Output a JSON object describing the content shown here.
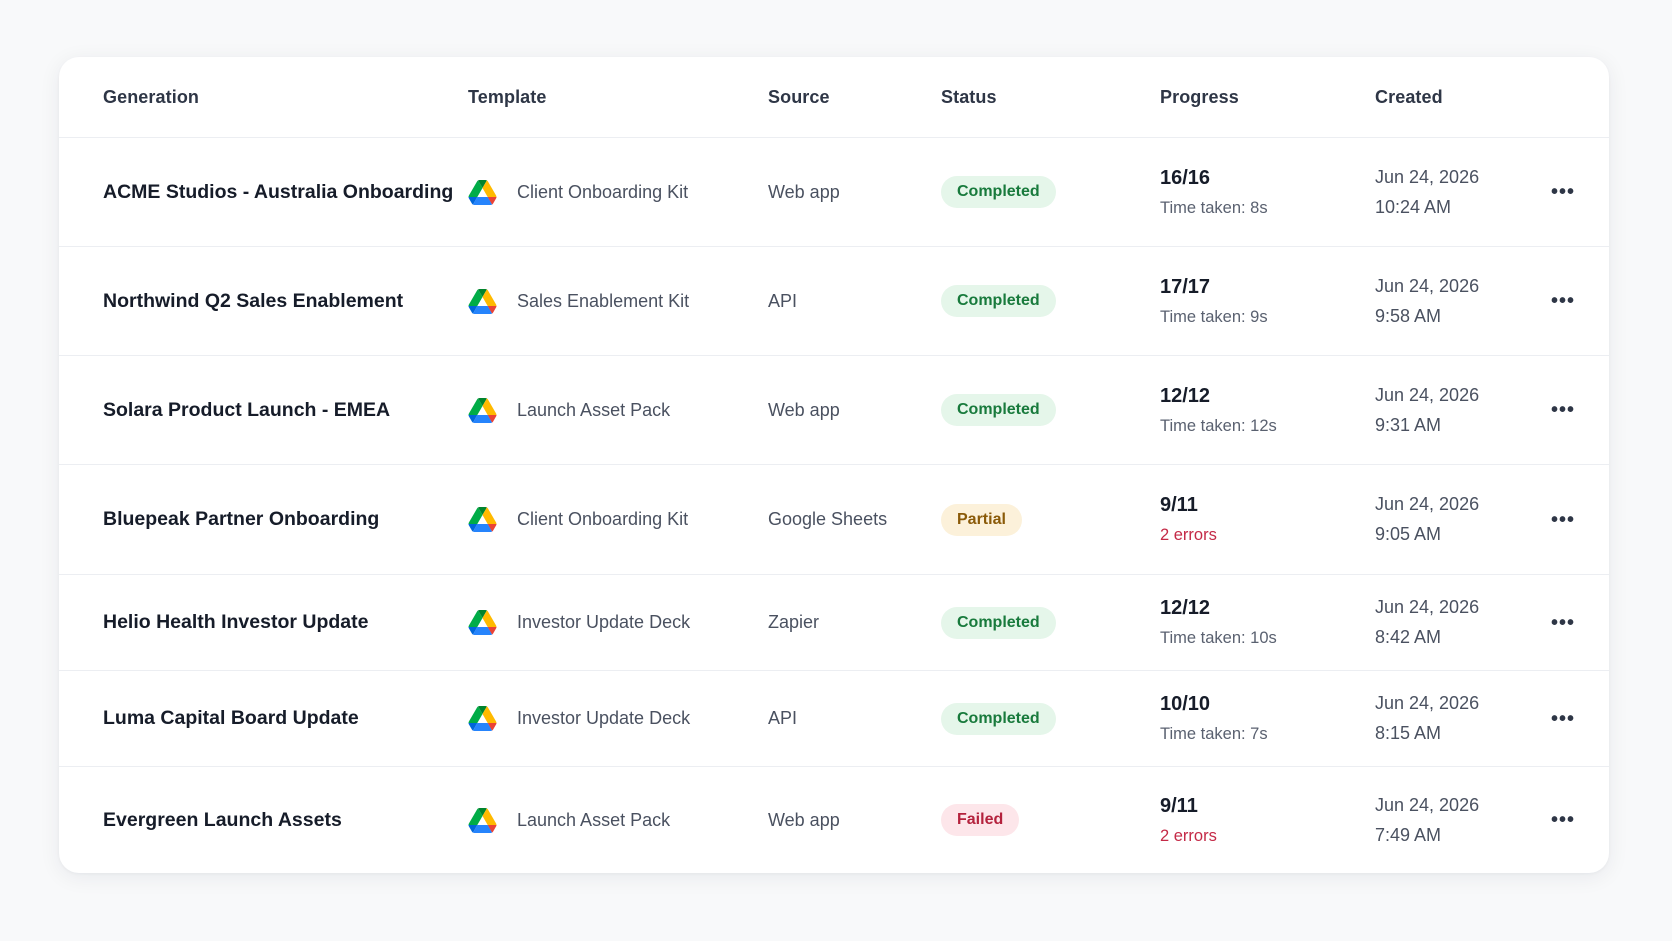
{
  "columns": {
    "generation": "Generation",
    "template": "Template",
    "source": "Source",
    "status": "Status",
    "progress": "Progress",
    "created": "Created"
  },
  "more_glyph": "•••",
  "status_colors": {
    "completed": "#187a3c",
    "partial": "#8a5a08",
    "failed": "#b4223d"
  },
  "rows": [
    {
      "generation": "ACME Studios - Australia Onboarding",
      "template_icon": "google-drive-icon",
      "template": "Client Onboarding Kit",
      "source": "Web app",
      "status": "Completed",
      "status_kind": "completed",
      "progress": "16/16",
      "progress_sub": "Time taken: 8s",
      "has_errors": false,
      "date": "Jun 24, 2026",
      "time": "10:24 AM"
    },
    {
      "generation": "Northwind Q2 Sales Enablement",
      "template_icon": "google-drive-icon",
      "template": "Sales Enablement Kit",
      "source": "API",
      "status": "Completed",
      "status_kind": "completed",
      "progress": "17/17",
      "progress_sub": "Time taken: 9s",
      "has_errors": false,
      "date": "Jun 24, 2026",
      "time": "9:58 AM"
    },
    {
      "generation": "Solara Product Launch - EMEA",
      "template_icon": "google-drive-icon",
      "template": "Launch Asset Pack",
      "source": "Web app",
      "status": "Completed",
      "status_kind": "completed",
      "progress": "12/12",
      "progress_sub": "Time taken: 12s",
      "has_errors": false,
      "date": "Jun 24, 2026",
      "time": "9:31 AM"
    },
    {
      "generation": "Bluepeak Partner Onboarding",
      "template_icon": "google-drive-icon",
      "template": "Client Onboarding Kit",
      "source": "Google Sheets",
      "status": "Partial",
      "status_kind": "partial",
      "progress": "9/11",
      "progress_sub": "2 errors",
      "has_errors": true,
      "date": "Jun 24, 2026",
      "time": "9:05 AM"
    },
    {
      "generation": "Helio Health Investor Update",
      "template_icon": "google-drive-icon",
      "template": "Investor Update Deck",
      "source": "Zapier",
      "status": "Completed",
      "status_kind": "completed",
      "progress": "12/12",
      "progress_sub": "Time taken: 10s",
      "has_errors": false,
      "date": "Jun 24, 2026",
      "time": "8:42 AM"
    },
    {
      "generation": "Luma Capital Board Update",
      "template_icon": "google-drive-icon",
      "template": "Investor Update Deck",
      "source": "API",
      "status": "Completed",
      "status_kind": "completed",
      "progress": "10/10",
      "progress_sub": "Time taken: 7s",
      "has_errors": false,
      "date": "Jun 24, 2026",
      "time": "8:15 AM"
    },
    {
      "generation": "Evergreen Launch Assets",
      "template_icon": "google-drive-icon",
      "template": "Launch Asset Pack",
      "source": "Web app",
      "status": "Failed",
      "status_kind": "failed",
      "progress": "9/11",
      "progress_sub": "2 errors",
      "has_errors": true,
      "date": "Jun 24, 2026",
      "time": "7:49 AM"
    }
  ]
}
